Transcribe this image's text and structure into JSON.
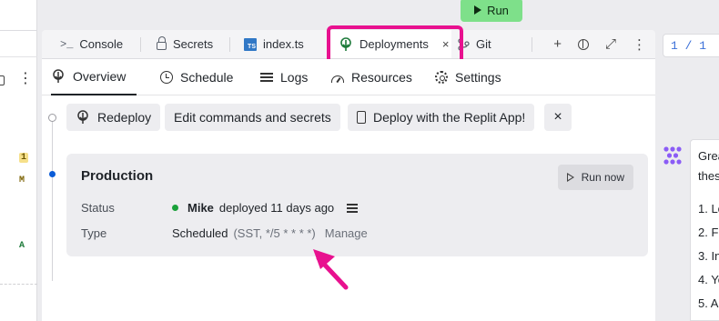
{
  "left_panel": {
    "badges": {
      "count": "1",
      "modified": "M",
      "added": "A"
    }
  },
  "run_button": {
    "label": "Run"
  },
  "tabs": [
    {
      "label": "Console",
      "icon": "terminal-icon",
      "glyph": ">_"
    },
    {
      "label": "Secrets",
      "icon": "lock-icon"
    },
    {
      "label": "index.ts",
      "icon": "typescript-file-icon",
      "badge": "TS"
    },
    {
      "label": "Deployments",
      "icon": "deployments-icon",
      "active": true,
      "close": "×"
    },
    {
      "label": "Git",
      "icon": "git-branch-icon"
    }
  ],
  "tab_actions": {
    "add": "+",
    "split": "split-pane-icon",
    "expand": "⤢",
    "more": "⋮"
  },
  "subtabs": [
    {
      "label": "Overview",
      "active": true
    },
    {
      "label": "Schedule"
    },
    {
      "label": "Logs"
    },
    {
      "label": "Resources"
    },
    {
      "label": "Settings"
    }
  ],
  "actions": {
    "redeploy": "Redeploy",
    "edit": "Edit commands and secrets",
    "app": "Deploy with the Replit App!",
    "dismiss": "×"
  },
  "production": {
    "title": "Production",
    "run_now": "Run now",
    "status_label": "Status",
    "user": "Mike",
    "status_text": "deployed 11 days ago",
    "type_label": "Type",
    "type_value": "Scheduled",
    "schedule": "(SST, */5 * * * *)",
    "manage": "Manage"
  },
  "right_panel": {
    "counter": "1 / 1",
    "chat_lines": [
      "Grea",
      "thes",
      "1. Lo",
      "2. Fi",
      "3. In",
      "4. Yo",
      "5. A"
    ]
  },
  "colors": {
    "highlight": "#e8118f",
    "run": "#7ee08a",
    "status_ok": "#1aa13a",
    "timeline_dot": "#0b5cd7"
  }
}
